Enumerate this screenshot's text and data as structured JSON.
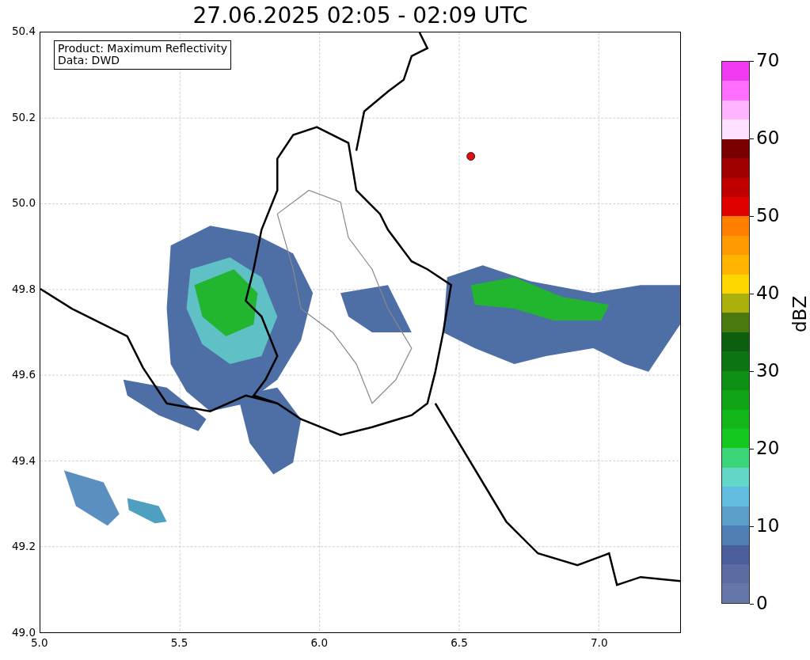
{
  "title": "27.06.2025 02:05 - 02:09 UTC",
  "map": {
    "info_lines": [
      "Product: Maximum Reflectivity",
      "Data: DWD"
    ],
    "x_ticks": [
      "5.0",
      "5.5",
      "6.0",
      "6.5",
      "7.0"
    ],
    "y_ticks": [
      "50.4",
      "50.2",
      "50.0",
      "49.8",
      "49.6",
      "49.4",
      "49.2",
      "49.0"
    ]
  },
  "colorbar": {
    "label": "dBZ",
    "ticks": [
      "70",
      "60",
      "50",
      "40",
      "30",
      "20",
      "10",
      "0"
    ],
    "segments": [
      {
        "color": "#f03cf0"
      },
      {
        "color": "#ff6eff"
      },
      {
        "color": "#ffb4ff"
      },
      {
        "color": "#ffe0ff"
      },
      {
        "color": "#7a0000"
      },
      {
        "color": "#a00000"
      },
      {
        "color": "#c00000"
      },
      {
        "color": "#e00000"
      },
      {
        "color": "#ff7f00"
      },
      {
        "color": "#ff9a00"
      },
      {
        "color": "#ffb400"
      },
      {
        "color": "#ffd700"
      },
      {
        "color": "#aab00c"
      },
      {
        "color": "#4a7a0e"
      },
      {
        "color": "#0b5f0e"
      },
      {
        "color": "#0c7512"
      },
      {
        "color": "#0e9014"
      },
      {
        "color": "#10a517"
      },
      {
        "color": "#12b81a"
      },
      {
        "color": "#14c820"
      },
      {
        "color": "#3dd57a"
      },
      {
        "color": "#62d6c8"
      },
      {
        "color": "#63bde0"
      },
      {
        "color": "#5b9fca"
      },
      {
        "color": "#4f7fb5"
      },
      {
        "color": "#4a5e9e"
      },
      {
        "color": "#5a6ca2"
      },
      {
        "color": "#6477a8"
      }
    ]
  }
}
